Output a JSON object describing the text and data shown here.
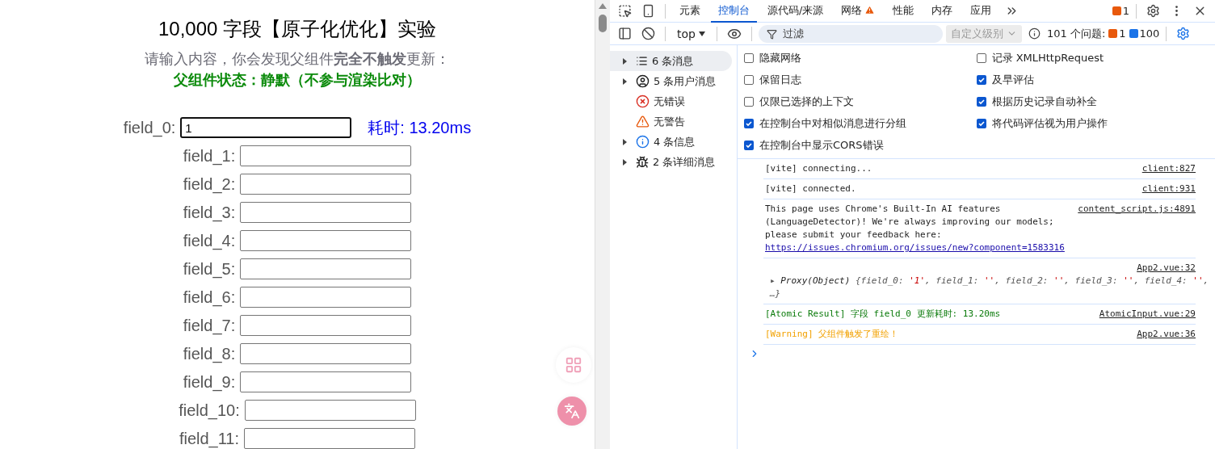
{
  "page": {
    "title": "10,000 字段【原子化优化】实验",
    "subtitle": "请输入内容，你会发现父组件**完全不触发**更新：",
    "status": "父组件状态：静默（不参与渲染比对）",
    "fields": [
      {
        "label": "field_0:",
        "value": "1",
        "focused": true,
        "timing": "耗时: 13.20ms"
      },
      {
        "label": "field_1:",
        "focused": false
      },
      {
        "label": "field_2:",
        "focused": false
      },
      {
        "label": "field_3:",
        "focused": false
      },
      {
        "label": "field_4:",
        "focused": false
      },
      {
        "label": "field_5:",
        "focused": false
      },
      {
        "label": "field_6:",
        "focused": false
      },
      {
        "label": "field_7:",
        "focused": false
      },
      {
        "label": "field_8:",
        "focused": false
      },
      {
        "label": "field_9:",
        "focused": false
      },
      {
        "label": "field_10:",
        "focused": false
      },
      {
        "label": "field_11:",
        "focused": false
      }
    ]
  },
  "devtools": {
    "tabs": [
      {
        "label": "元素",
        "selected": false,
        "warning": false
      },
      {
        "label": "控制台",
        "selected": true,
        "warning": false
      },
      {
        "label": "源代码/来源",
        "selected": false,
        "warning": false
      },
      {
        "label": "网络",
        "selected": false,
        "warning": true
      },
      {
        "label": "性能",
        "selected": false,
        "warning": false
      },
      {
        "label": "内存",
        "selected": false,
        "warning": false
      },
      {
        "label": "应用",
        "selected": false,
        "warning": false
      }
    ],
    "issue_badge": "1",
    "context": "top",
    "filter_placeholder": "过滤",
    "levels": "自定义级别",
    "issues_label": "101 个问题:",
    "issue_errors": "1",
    "issue_infos": "100",
    "sidebar": [
      {
        "kind": "messages",
        "label": "6 条消息",
        "expandable": true,
        "selected": true
      },
      {
        "kind": "user",
        "label": "5 条用户消息",
        "expandable": true,
        "selected": false
      },
      {
        "kind": "error",
        "label": "无错误",
        "expandable": false,
        "selected": false
      },
      {
        "kind": "warning",
        "label": "无警告",
        "expandable": false,
        "selected": false
      },
      {
        "kind": "info",
        "label": "4 条信息",
        "expandable": true,
        "selected": false
      },
      {
        "kind": "verbose",
        "label": "2 条详细消息",
        "expandable": true,
        "selected": false
      }
    ],
    "settings_left": [
      {
        "label": "隐藏网络",
        "checked": false
      },
      {
        "label": "保留日志",
        "checked": false
      },
      {
        "label": "仅限已选择的上下文",
        "checked": false
      },
      {
        "label": "在控制台中对相似消息进行分组",
        "checked": true
      },
      {
        "label": "在控制台中显示CORS错误",
        "checked": true
      }
    ],
    "settings_right": [
      {
        "label": "记录 XMLHttpRequest",
        "checked": false
      },
      {
        "label": "及早评估",
        "checked": true
      },
      {
        "label": "根据历史记录自动补全",
        "checked": true
      },
      {
        "label": "将代码评估视为用户操作",
        "checked": true
      }
    ],
    "messages": [
      {
        "kind": "log",
        "text": "[vite] connecting...",
        "source": "client:827"
      },
      {
        "kind": "log",
        "text": "[vite] connected.",
        "source": "client:931"
      },
      {
        "kind": "log",
        "text": "This page uses Chrome's Built-In AI features (LanguageDetector)! We're always improving our models; please submit your feedback here:",
        "link": "https://issues.chromium.org/issues/new?component=1583316",
        "source": "content_script.js:4891"
      },
      {
        "kind": "object",
        "expander": "▸",
        "label": "Proxy(Object)",
        "tokens": [
          {
            "kind": "key",
            "text": "{field_0: "
          },
          {
            "kind": "value",
            "text": "'1'"
          },
          {
            "kind": "key",
            "text": ", field_1: "
          },
          {
            "kind": "value",
            "text": "''"
          },
          {
            "kind": "key",
            "text": ", field_2: "
          },
          {
            "kind": "value",
            "text": "''"
          },
          {
            "kind": "key",
            "text": ", field_3: "
          },
          {
            "kind": "value",
            "text": "''"
          },
          {
            "kind": "key",
            "text": ", field_4: "
          },
          {
            "kind": "value",
            "text": "''"
          },
          {
            "kind": "key",
            "text": ",  …}"
          }
        ],
        "source": "App2.vue:32"
      },
      {
        "kind": "result",
        "text": "[Atomic Result] 字段 field_0 更新耗时: 13.20ms",
        "source": "AtomicInput.vue:29"
      },
      {
        "kind": "warning",
        "text": "[Warning] 父组件触发了重绘！",
        "source": "App2.vue:36"
      }
    ]
  }
}
